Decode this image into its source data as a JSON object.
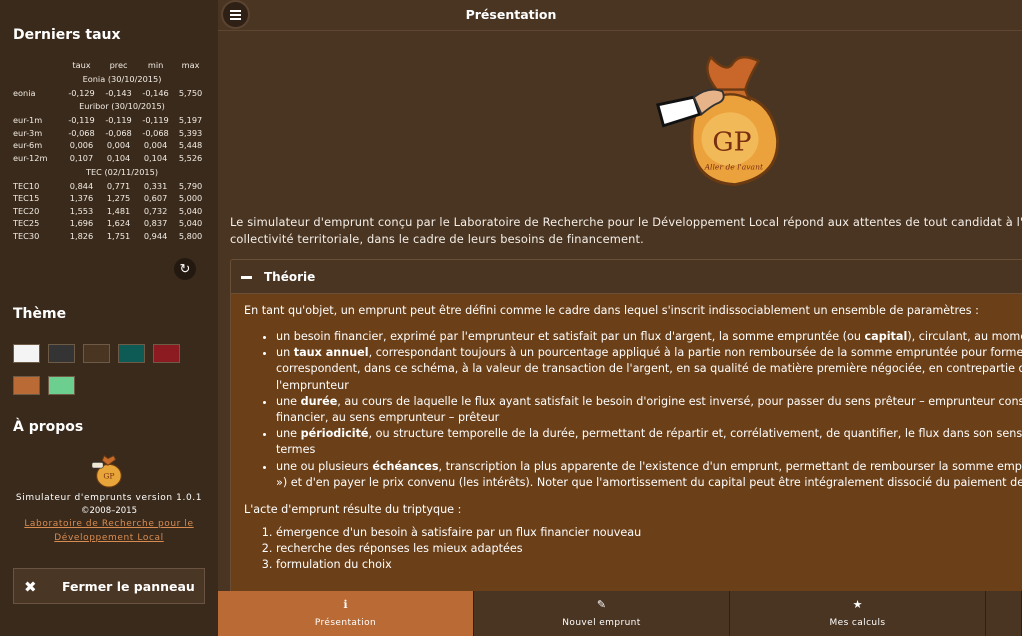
{
  "sidebar": {
    "rates_title": "Derniers taux",
    "columns": [
      "taux",
      "prec",
      "min",
      "max"
    ],
    "groups": [
      {
        "label": "Eonia (30/10/2015)",
        "rows": [
          {
            "name": "eonia",
            "values": [
              "-0,129",
              "-0,143",
              "-0,146",
              "5,750"
            ]
          }
        ]
      },
      {
        "label": "Euribor (30/10/2015)",
        "rows": [
          {
            "name": "eur-1m",
            "values": [
              "-0,119",
              "-0,119",
              "-0,119",
              "5,197"
            ]
          },
          {
            "name": "eur-3m",
            "values": [
              "-0,068",
              "-0,068",
              "-0,068",
              "5,393"
            ]
          },
          {
            "name": "eur-6m",
            "values": [
              "0,006",
              "0,004",
              "0,004",
              "5,448"
            ]
          },
          {
            "name": "eur-12m",
            "values": [
              "0,107",
              "0,104",
              "0,104",
              "5,526"
            ]
          }
        ]
      },
      {
        "label": "TEC (02/11/2015)",
        "rows": [
          {
            "name": "TEC10",
            "values": [
              "0,844",
              "0,771",
              "0,331",
              "5,790"
            ]
          },
          {
            "name": "TEC15",
            "values": [
              "1,376",
              "1,275",
              "0,607",
              "5,000"
            ]
          },
          {
            "name": "TEC20",
            "values": [
              "1,553",
              "1,481",
              "0,732",
              "5,040"
            ]
          },
          {
            "name": "TEC25",
            "values": [
              "1,696",
              "1,624",
              "0,837",
              "5,040"
            ]
          },
          {
            "name": "TEC30",
            "values": [
              "1,826",
              "1,751",
              "0,944",
              "5,800"
            ]
          }
        ]
      }
    ],
    "refresh_icon": "refresh-icon",
    "theme_title": "Thème",
    "theme_colors": [
      "#f4f4f4",
      "#343434",
      "#4a3522",
      "#0e5b55",
      "#8c1b21",
      "#b96a35",
      "#6ccf8f"
    ],
    "about_title": "À propos",
    "about_version": "Simulateur d'emprunts version 1.0.1",
    "about_copyright": "©2008–2015",
    "about_link": "Laboratoire de Recherche pour le Développement Local",
    "close_label": "Fermer le panneau"
  },
  "header": {
    "title": "Présentation",
    "menu_icon": "menu-icon"
  },
  "main": {
    "intro": "Le simulateur d'emprunt conçu par le Laboratoire de Recherche pour le Développement Local répond aux attentes de tout candidat à l'emprunt, c collectivité territoriale, dans le cadre de leurs besoins de financement.",
    "logo_initials": "GP",
    "logo_slogan": "Aller de l'avant",
    "panel": {
      "title": "Théorie",
      "para1": "En tant qu'objet, un emprunt peut être défini comme le cadre dans lequel s'inscrit indissociablement un ensemble de paramètres :",
      "bullets": [
        {
          "pre": "un besoin financier, exprimé par l'emprunteur et satisfait par un flux d'argent, la somme empruntée (ou ",
          "bold": "capital",
          "post": "), circulant, au moment vou"
        },
        {
          "pre": "un ",
          "bold": "taux annuel",
          "post": ", correspondant toujours à un pourcentage appliqué à la partie non remboursée de la somme empruntée pour former les",
          "lines": [
            "correspondent, dans ce schéma, à la valeur de transaction de l'argent, en sa qualité de matière première négociée, en contrepartie du b",
            "l'emprunteur"
          ]
        },
        {
          "pre": "une ",
          "bold": "durée",
          "post": ", au cours de laquelle le flux ayant satisfait le besoin d'origine est inversé, pour passer du sens prêteur – emprunteur constaté",
          "lines": [
            "financier, au sens emprunteur – prêteur"
          ]
        },
        {
          "pre": "une ",
          "bold": "périodicité",
          "post": ", ou structure temporelle de la durée, permettant de répartir et, corrélativement, de quantifier, le flux dans son sens empru",
          "lines": [
            "termes"
          ]
        },
        {
          "pre": "une ou plusieurs ",
          "bold": "échéances",
          "post": ", transcription la plus apparente de l'existence d'un emprunt, permettant de rembourser la somme empruntée",
          "lines": [
            "») et d'en payer le prix convenu (les intérêts). Noter que l'amortissement du capital peut être intégralement dissocié du paiement des intér"
          ]
        }
      ],
      "para2": "L'acte d'emprunt résulte du triptyque :",
      "steps": [
        "émergence d'un besoin à satisfaire par un flux financier nouveau",
        "recherche des réponses les mieux adaptées",
        "formulation du choix"
      ]
    }
  },
  "footer": {
    "tabs": [
      {
        "label": "Présentation",
        "icon": "info-icon",
        "glyph": "ℹ"
      },
      {
        "label": "Nouvel emprunt",
        "icon": "pencil-icon",
        "glyph": "✎"
      },
      {
        "label": "Mes calculs",
        "icon": "star-icon",
        "glyph": "★"
      }
    ]
  }
}
